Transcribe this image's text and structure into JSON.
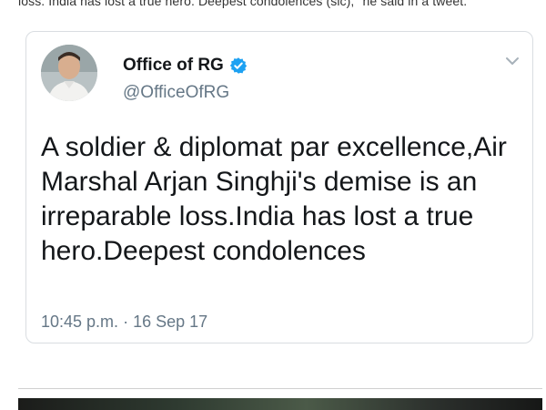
{
  "article": {
    "snippet": "loss. India has lost a true hero. Deepest condolences (sic),\" he said in a tweet."
  },
  "tweet": {
    "display_name": "Office of RG",
    "handle": "@OfficeOfRG",
    "text": "A soldier & diplomat par excellence,Air Marshal Arjan Singhji's demise is an irreparable loss.India has lost a true hero.Deepest condolences",
    "timestamp": "10:45 p.m.",
    "separator": "·",
    "date": "16 Sep 17",
    "verified": true,
    "icons": {
      "avatar": "profile-photo",
      "verified": "verified-badge-icon",
      "menu": "chevron-down-icon"
    }
  },
  "colors": {
    "verified_blue": "#1da1f2",
    "text_primary": "#14171a",
    "text_secondary": "#657786",
    "card_border": "#d9dde1"
  }
}
